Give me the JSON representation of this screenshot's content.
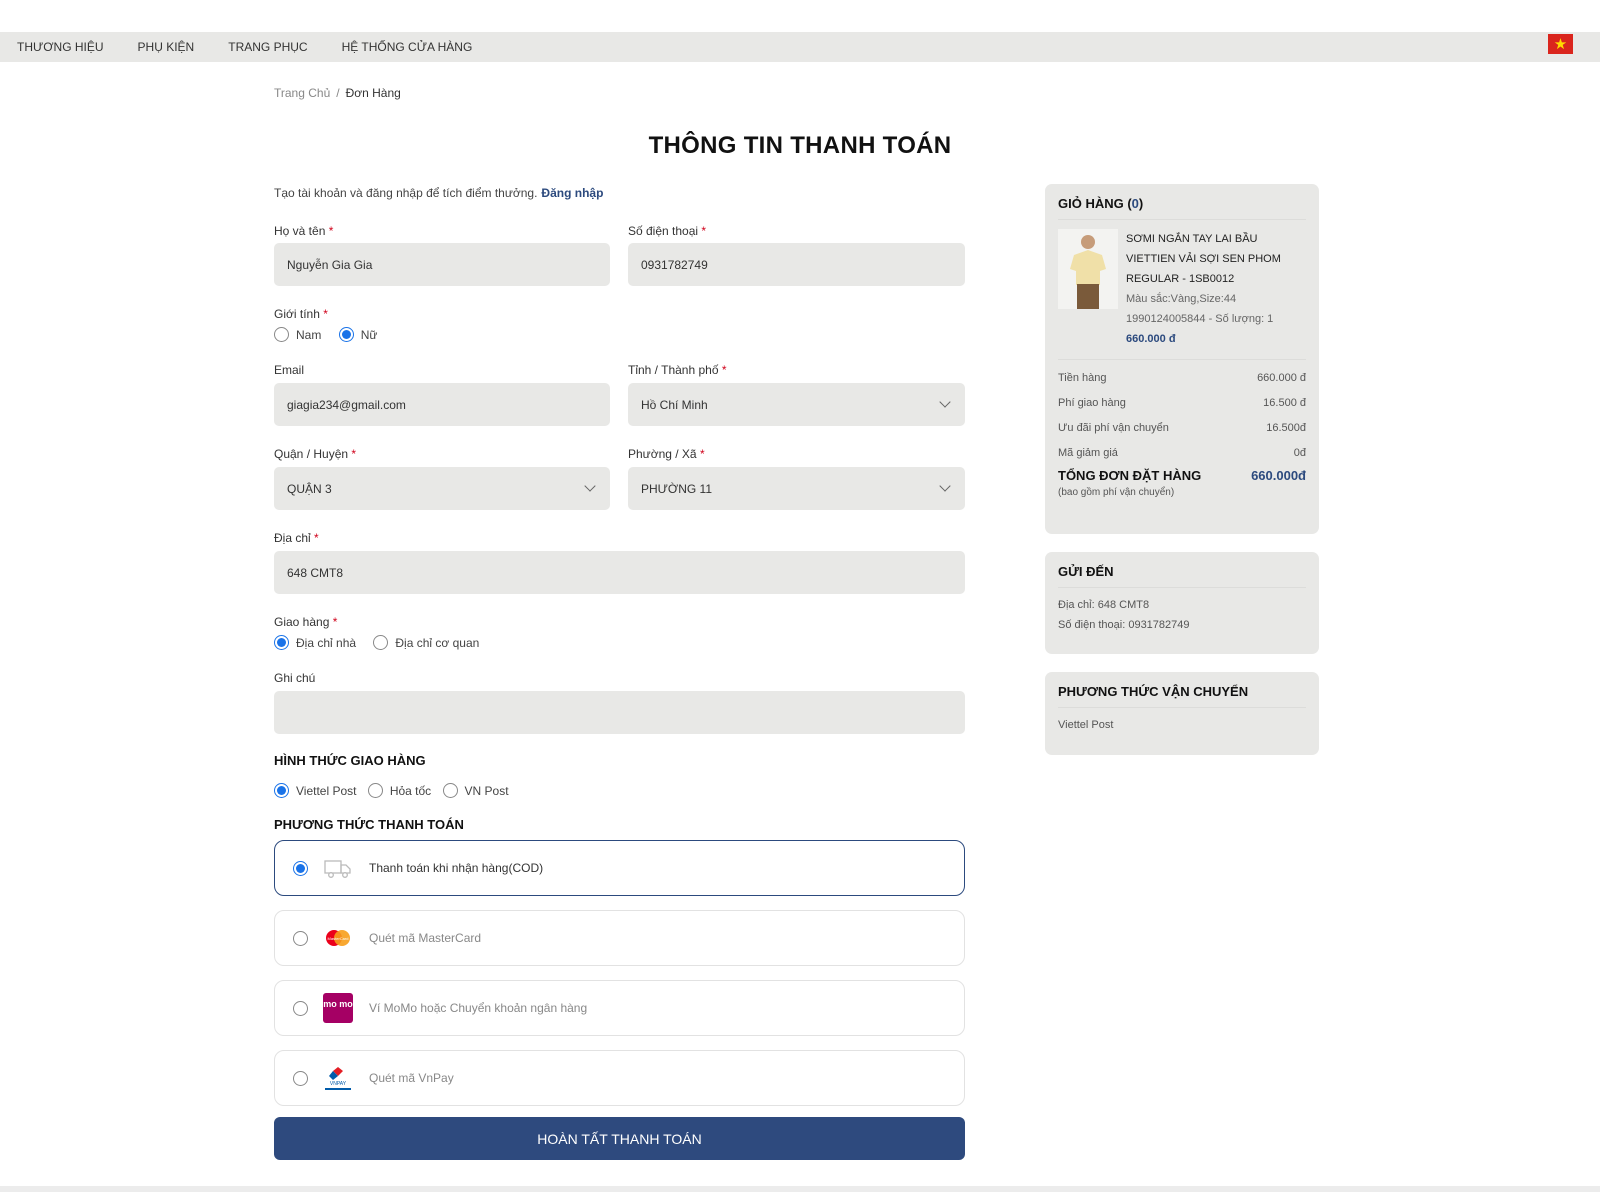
{
  "nav": {
    "items": [
      "THƯƠNG HIỆU",
      "PHỤ KIỆN",
      "TRANG PHỤC",
      "HỆ THỐNG CỬA HÀNG"
    ],
    "flag_icon": "vietnam-flag-icon"
  },
  "breadcrumb": {
    "home": "Trang Chủ",
    "separator": "/",
    "current": "Đơn Hàng"
  },
  "title": "THÔNG TIN THANH TOÁN",
  "login_hint": {
    "text": "Tạo tài khoản và đăng nhập để tích điểm thưởng.",
    "link": "Đăng nhập"
  },
  "form": {
    "required_mark": "*",
    "fullname": {
      "label": "Họ và tên",
      "value": "Nguyễn Gia Gia"
    },
    "phone": {
      "label": "Số điện thoại",
      "value": "0931782749"
    },
    "gender": {
      "label": "Giới tính",
      "options": [
        "Nam",
        "Nữ"
      ],
      "selected": "Nữ"
    },
    "email": {
      "label": "Email",
      "value": "giagia234@gmail.com"
    },
    "city": {
      "label": "Tỉnh / Thành phố",
      "value": "Hồ Chí Minh"
    },
    "district": {
      "label": "Quận / Huyện",
      "value": "QUẬN 3"
    },
    "ward": {
      "label": "Phường / Xã",
      "value": "PHƯỜNG 11"
    },
    "address": {
      "label": "Địa chỉ",
      "value": "648 CMT8"
    },
    "delivery": {
      "label": "Giao hàng",
      "options": [
        "Địa chỉ nhà",
        "Địa chỉ cơ quan"
      ],
      "selected": "Địa chỉ nhà"
    },
    "note": {
      "label": "Ghi chú",
      "value": ""
    }
  },
  "shipping": {
    "heading": "HÌNH THỨC GIAO HÀNG",
    "options": [
      "Viettel Post",
      "Hỏa tốc",
      "VN Post"
    ],
    "selected": "Viettel Post"
  },
  "payment": {
    "heading": "PHƯƠNG THỨC THANH TOÁN",
    "methods": [
      {
        "label": "Thanh toán khi nhận hàng(COD)",
        "icon": "delivery-truck-icon",
        "selected": true
      },
      {
        "label": "Quét mã MasterCard",
        "icon": "mastercard-icon",
        "icon_text": "MasterCard",
        "selected": false
      },
      {
        "label": "Ví MoMo hoặc Chuyển khoản ngân hàng",
        "icon": "momo-icon",
        "icon_text": "mo mo",
        "selected": false
      },
      {
        "label": "Quét mã VnPay",
        "icon": "vnpay-icon",
        "icon_text": "VNPAY",
        "selected": false
      }
    ]
  },
  "submit_label": "HOÀN TẤT THANH TOÁN",
  "cart": {
    "heading": "GIỎ HÀNG (",
    "count": "0",
    "heading_close": ")",
    "item": {
      "name": "SƠMI NGẮN TAY LAI BẦU VIETTIEN VẢI SỢI SEN PHOM REGULAR - 1SB0012",
      "variant": "Màu sắc:Vàng,Size:44",
      "sku_qty": "1990124005844 - Số lượng: 1",
      "price": "660.000 đ"
    },
    "summary": [
      {
        "label": "Tiền hàng",
        "value": "660.000 đ"
      },
      {
        "label": "Phí giao hàng",
        "value": "16.500 đ"
      },
      {
        "label": "Ưu đãi phí vận chuyển",
        "value": "16.500đ"
      },
      {
        "label": "Mã giảm giá",
        "value": "0đ"
      }
    ],
    "total_label": "TỔNG ĐƠN ĐẶT HÀNG",
    "total_value": "660.000đ",
    "total_note": "(bao gồm phí vận chuyển)"
  },
  "ship_to": {
    "heading": "GỬI ĐẾN",
    "address": "Địa chỉ: 648 CMT8",
    "phone": "Số điện thoại: 0931782749"
  },
  "ship_method": {
    "heading": "PHƯƠNG THỨC VẬN CHUYỂN",
    "value": "Viettel Post"
  },
  "colors": {
    "accent": "#2e4a7e",
    "radio": "#1a73e8",
    "field_bg": "#e8e8e6",
    "required": "#d0021b"
  }
}
